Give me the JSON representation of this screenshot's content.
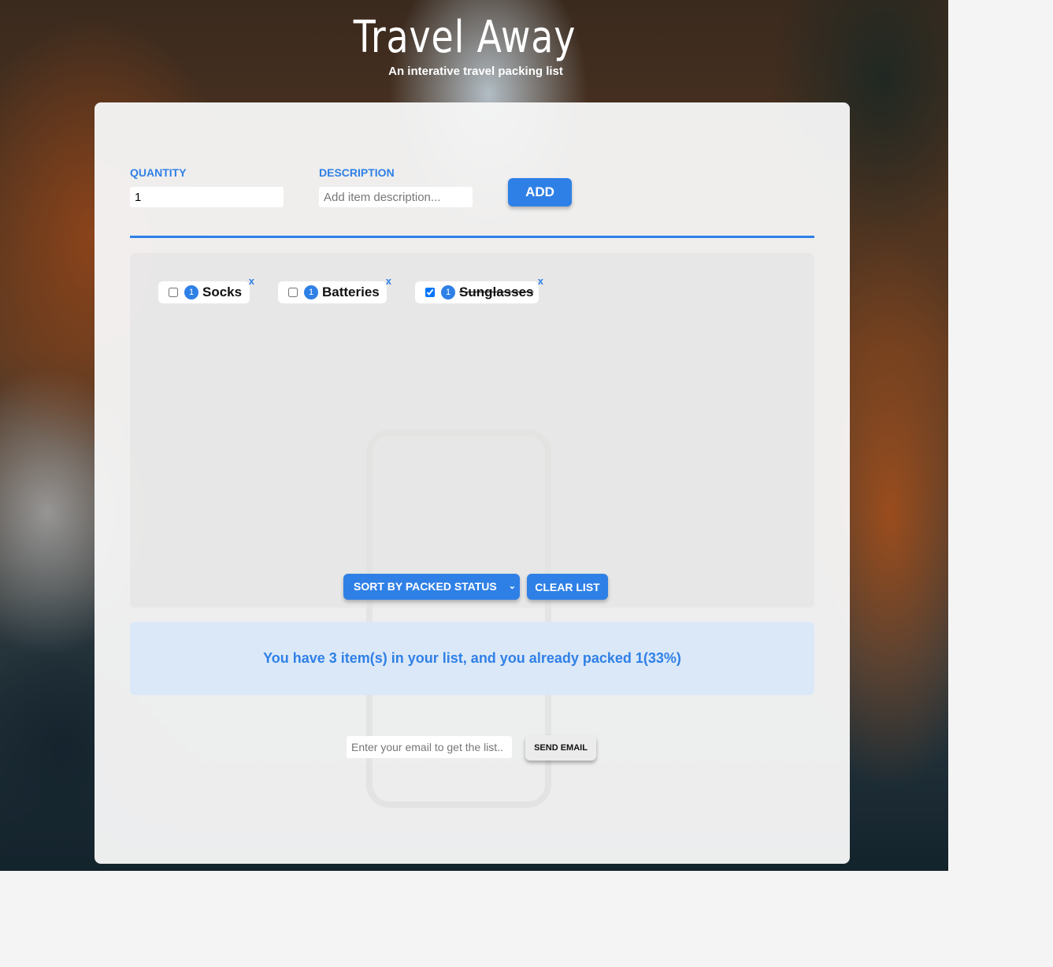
{
  "header": {
    "title": "Travel Away",
    "subtitle": "An interative travel packing list"
  },
  "form": {
    "quantity_label": "QUANTITY",
    "quantity_value": "1",
    "description_label": "DESCRIPTION",
    "description_placeholder": "Add item description...",
    "add_label": "ADD"
  },
  "items": [
    {
      "quantity": "1",
      "description": "Socks",
      "packed": false,
      "remove": "x"
    },
    {
      "quantity": "1",
      "description": "Batteries",
      "packed": false,
      "remove": "x"
    },
    {
      "quantity": "1",
      "description": "Sunglasses",
      "packed": true,
      "remove": "x"
    }
  ],
  "actions": {
    "sort_selected": "SORT BY PACKED STATUS",
    "clear_label": "CLEAR LIST"
  },
  "stats": {
    "text": "You have 3 item(s) in your list, and you already packed 1(33%)"
  },
  "email": {
    "placeholder": "Enter your email to get the list..",
    "send_label": "SEND EMAIL"
  },
  "colors": {
    "accent": "#2f80e6",
    "stats_bg": "#dbe8f8"
  }
}
